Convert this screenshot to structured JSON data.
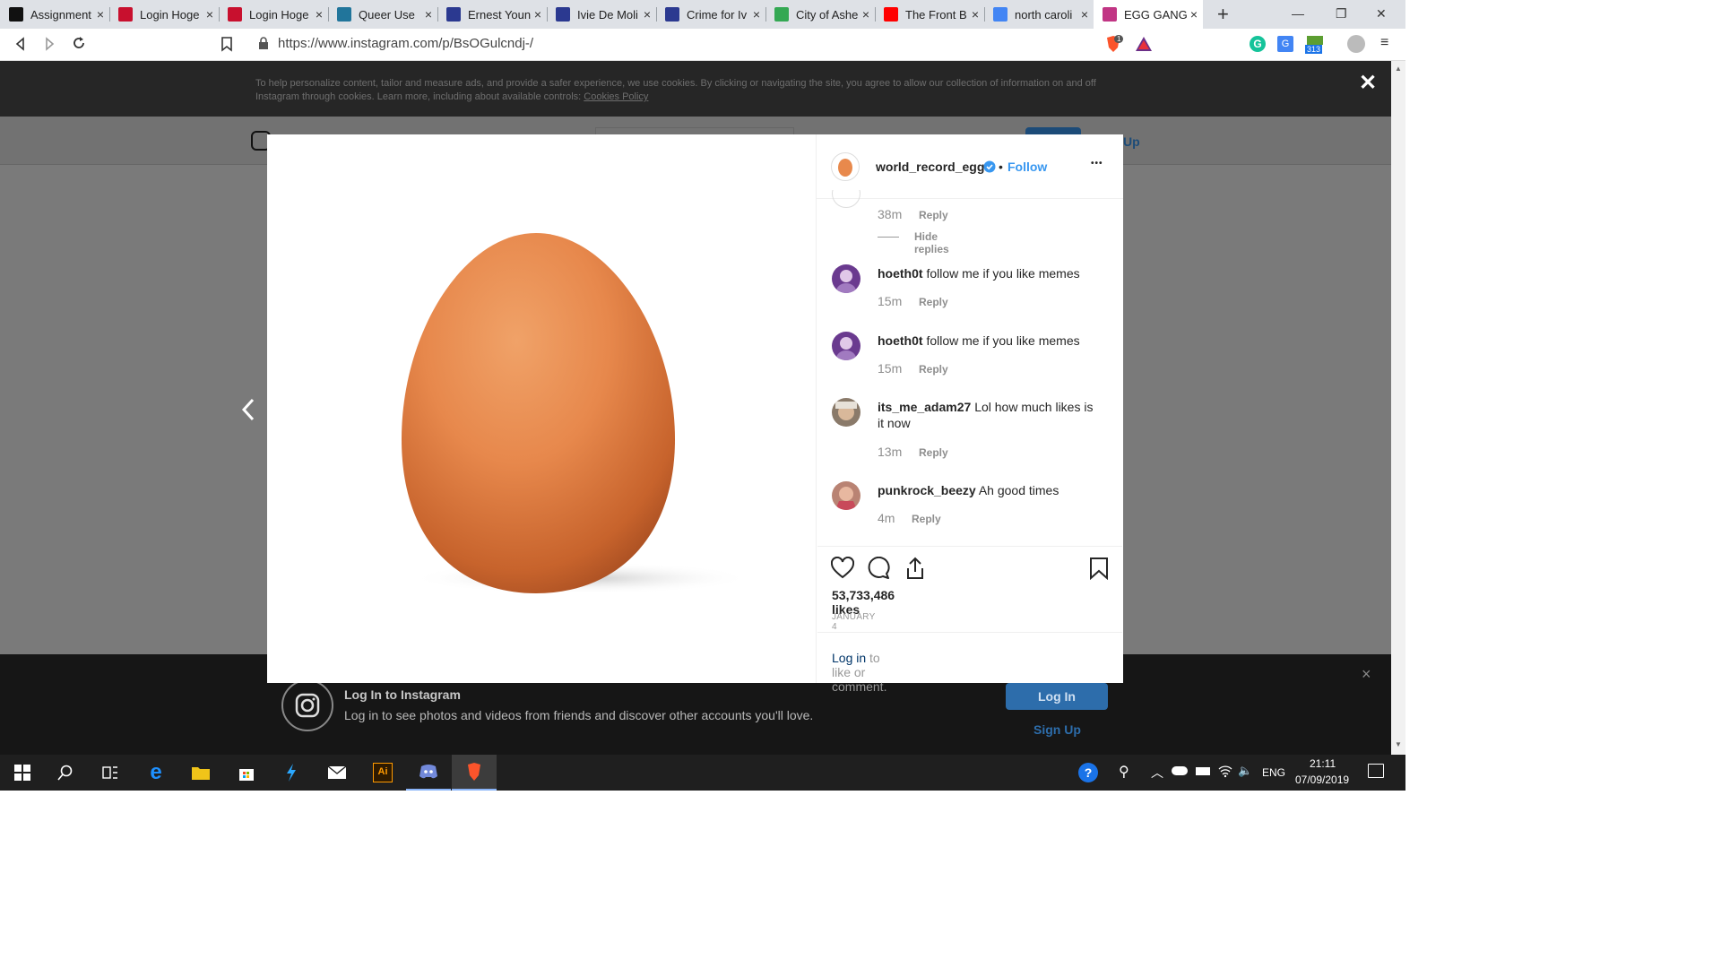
{
  "browser": {
    "tabs": [
      {
        "label": "Assignment",
        "favicon": "black-square-icon",
        "color": "#111111"
      },
      {
        "label": "Login Hoge",
        "favicon": "hoge-icon",
        "color": "#c8102e"
      },
      {
        "label": "Login Hoge",
        "favicon": "hoge-icon",
        "color": "#c8102e"
      },
      {
        "label": "Queer Use",
        "favicon": "wordpress-icon",
        "color": "#21759b"
      },
      {
        "label": "Ernest Youn",
        "favicon": "triangle-logo-icon",
        "color": "#2b3990"
      },
      {
        "label": "Ivie De Moli",
        "favicon": "triangle-logo-icon",
        "color": "#2b3990"
      },
      {
        "label": "Crime for Iv",
        "favicon": "triangle-logo-icon",
        "color": "#2b3990"
      },
      {
        "label": "City of Ashe",
        "favicon": "maps-icon",
        "color": "#34a853"
      },
      {
        "label": "The Front B",
        "favicon": "youtube-icon",
        "color": "#ff0000"
      },
      {
        "label": "north caroli",
        "favicon": "google-icon",
        "color": "#4285f4"
      },
      {
        "label": "EGG GANG",
        "favicon": "instagram-icon",
        "color": "#c13584",
        "active": true
      }
    ],
    "new_tab": "+",
    "close_glyph": "×",
    "url": "https://www.instagram.com/p/BsOGulcndj-/",
    "extension_badge": "313",
    "brave_badge": "1"
  },
  "cookie_banner": {
    "text": "To help personalize content, tailor and measure ads, and provide a safer experience, we use cookies. By clicking or navigating the site, you agree to allow our collection of information on and off Instagram through cookies. Learn more, including about available controls:",
    "link": "Cookies Policy",
    "close": "✕"
  },
  "nav": {
    "signup_partial": "Up"
  },
  "post": {
    "username": "world_record_egg",
    "dot": "•",
    "follow": "Follow",
    "more": "•••",
    "prev_comment_time": "38m",
    "prev_comment_reply": "Reply",
    "hide_replies": "Hide replies",
    "comments": [
      {
        "user": "hoeth0t",
        "text": "follow me if you like memes",
        "time": "15m",
        "reply": "Reply"
      },
      {
        "user": "hoeth0t",
        "text": "follow me if you like memes",
        "time": "15m",
        "reply": "Reply"
      },
      {
        "user": "its_me_adam27",
        "text": "Lol how much likes is it now",
        "time": "13m",
        "reply": "Reply"
      },
      {
        "user": "punkrock_beezy",
        "text": "Ah good times",
        "time": "4m",
        "reply": "Reply"
      }
    ],
    "likes": "53,733,486 likes",
    "date": "JANUARY 4",
    "login_link": "Log in",
    "login_rest": "to like or comment."
  },
  "login_bar": {
    "title": "Log In to Instagram",
    "subtitle": "Log in to see photos and videos from friends and discover other accounts you'll love.",
    "login_button": "Log In",
    "signup": "Sign Up",
    "close": "×"
  },
  "taskbar": {
    "lang": "ENG",
    "time": "21:11",
    "date": "07/09/2019"
  },
  "colors": {
    "instagram_blue": "#3897f0",
    "link_blue": "#003569",
    "taskbar": "#1f1f1f"
  }
}
